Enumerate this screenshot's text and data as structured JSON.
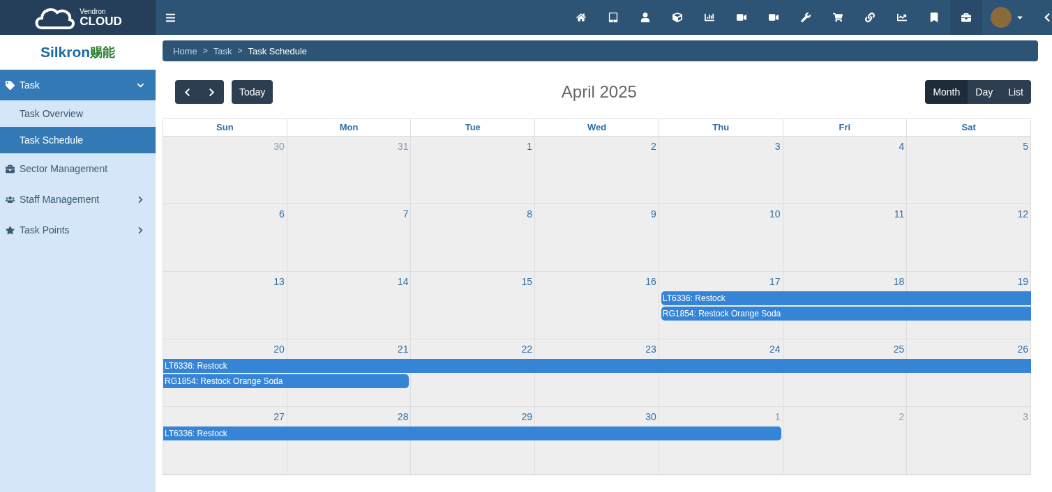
{
  "brand": {
    "small": "Vendron",
    "large": "CLOUD"
  },
  "company": {
    "latin": "Silkron",
    "cjk": "赐能"
  },
  "toolbar": {
    "icons": [
      {
        "kind": "home",
        "selected": false
      },
      {
        "kind": "tablet",
        "selected": false
      },
      {
        "kind": "user",
        "selected": false
      },
      {
        "kind": "cube",
        "selected": false
      },
      {
        "kind": "bars",
        "selected": false
      },
      {
        "kind": "video",
        "selected": false
      },
      {
        "kind": "video",
        "selected": false
      },
      {
        "kind": "wrench",
        "selected": false
      },
      {
        "kind": "cart",
        "selected": false
      },
      {
        "kind": "link",
        "selected": false
      },
      {
        "kind": "line",
        "selected": false
      },
      {
        "kind": "bookmark",
        "selected": false
      },
      {
        "kind": "briefcase",
        "selected": true
      }
    ]
  },
  "breadcrumb": [
    {
      "kind": "link",
      "text": "Home"
    },
    {
      "kind": "separator",
      "text": ">"
    },
    {
      "kind": "link",
      "text": "Task"
    },
    {
      "kind": "separator",
      "text": ">"
    },
    {
      "kind": "current",
      "text": "Task Schedule"
    }
  ],
  "sidebar": {
    "items": [
      {
        "label": "Task",
        "kind": "tag",
        "expanded": true,
        "selected": false,
        "children": [
          {
            "label": "Task Overview",
            "selected": false
          },
          {
            "label": "Task Schedule",
            "selected": true
          }
        ]
      },
      {
        "label": "Sector Management",
        "kind": "briefcase",
        "expanded": false,
        "selected": false
      },
      {
        "label": "Staff Management",
        "kind": "users",
        "expanded": false,
        "selected": false,
        "has_children": true
      },
      {
        "label": "Task Points",
        "kind": "star",
        "expanded": false,
        "selected": false,
        "has_children": true
      }
    ]
  },
  "calendar": {
    "title": "April 2025",
    "today": "Today",
    "views": [
      {
        "label": "Month",
        "selected": true
      },
      {
        "label": "Day",
        "selected": false
      },
      {
        "label": "List",
        "selected": false
      }
    ],
    "columns": [
      "Sun",
      "Mon",
      "Tue",
      "Wed",
      "Thu",
      "Fri",
      "Sat"
    ],
    "weeks": [
      {
        "days": [
          {
            "label": "30",
            "other_month": true
          },
          {
            "label": "31",
            "other_month": true
          },
          {
            "label": "1",
            "other_month": false
          },
          {
            "label": "2",
            "other_month": false
          },
          {
            "label": "3",
            "other_month": false
          },
          {
            "label": "4",
            "other_month": false
          },
          {
            "label": "5",
            "other_month": false
          }
        ]
      },
      {
        "days": [
          {
            "label": "6",
            "other_month": false
          },
          {
            "label": "7",
            "other_month": false
          },
          {
            "label": "8",
            "other_month": false
          },
          {
            "label": "9",
            "other_month": false
          },
          {
            "label": "10",
            "other_month": false
          },
          {
            "label": "11",
            "other_month": false
          },
          {
            "label": "12",
            "other_month": false
          }
        ]
      },
      {
        "days": [
          {
            "label": "13",
            "other_month": false
          },
          {
            "label": "14",
            "other_month": false
          },
          {
            "label": "15",
            "other_month": false
          },
          {
            "label": "16",
            "other_month": false
          },
          {
            "label": "17",
            "other_month": false
          },
          {
            "label": "18",
            "other_month": false
          },
          {
            "label": "19",
            "other_month": false
          }
        ],
        "event_rows": [
          [
            {
              "kind": "empty"
            },
            {
              "kind": "empty"
            },
            {
              "kind": "empty"
            },
            {
              "kind": "empty"
            },
            {
              "kind": "head",
              "title": "LT6336: Restock"
            },
            {
              "kind": "body"
            },
            {
              "kind": "body"
            }
          ],
          [
            {
              "kind": "empty"
            },
            {
              "kind": "empty"
            },
            {
              "kind": "empty"
            },
            {
              "kind": "empty"
            },
            {
              "kind": "head",
              "title": "RG1854: Restock Orange Soda"
            },
            {
              "kind": "body"
            },
            {
              "kind": "body"
            }
          ]
        ]
      },
      {
        "days": [
          {
            "label": "20",
            "other_month": false
          },
          {
            "label": "21",
            "other_month": false
          },
          {
            "label": "22",
            "other_month": false
          },
          {
            "label": "23",
            "other_month": false
          },
          {
            "label": "24",
            "other_month": false
          },
          {
            "label": "25",
            "other_month": false
          },
          {
            "label": "26",
            "other_month": false
          }
        ],
        "event_rows": [
          [
            {
              "kind": "carry_in",
              "title": "LT6336: Restock"
            },
            {
              "kind": "body"
            },
            {
              "kind": "body"
            },
            {
              "kind": "body"
            },
            {
              "kind": "body"
            },
            {
              "kind": "body"
            },
            {
              "kind": "body"
            }
          ],
          [
            {
              "kind": "carry_in",
              "title": "RG1854: Restock Orange Soda"
            },
            {
              "kind": "tail"
            },
            {
              "kind": "empty"
            },
            {
              "kind": "empty"
            },
            {
              "kind": "empty"
            },
            {
              "kind": "empty"
            },
            {
              "kind": "empty"
            }
          ]
        ]
      },
      {
        "days": [
          {
            "label": "27",
            "other_month": false
          },
          {
            "label": "28",
            "other_month": false
          },
          {
            "label": "29",
            "other_month": false
          },
          {
            "label": "30",
            "other_month": false
          },
          {
            "label": "1",
            "other_month": true
          },
          {
            "label": "2",
            "other_month": true
          },
          {
            "label": "3",
            "other_month": true
          }
        ],
        "event_rows": [
          [
            {
              "kind": "carry_in",
              "title": "LT6336: Restock"
            },
            {
              "kind": "body"
            },
            {
              "kind": "body"
            },
            {
              "kind": "body"
            },
            {
              "kind": "tail"
            },
            {
              "kind": "empty"
            },
            {
              "kind": "empty"
            }
          ]
        ]
      }
    ]
  }
}
